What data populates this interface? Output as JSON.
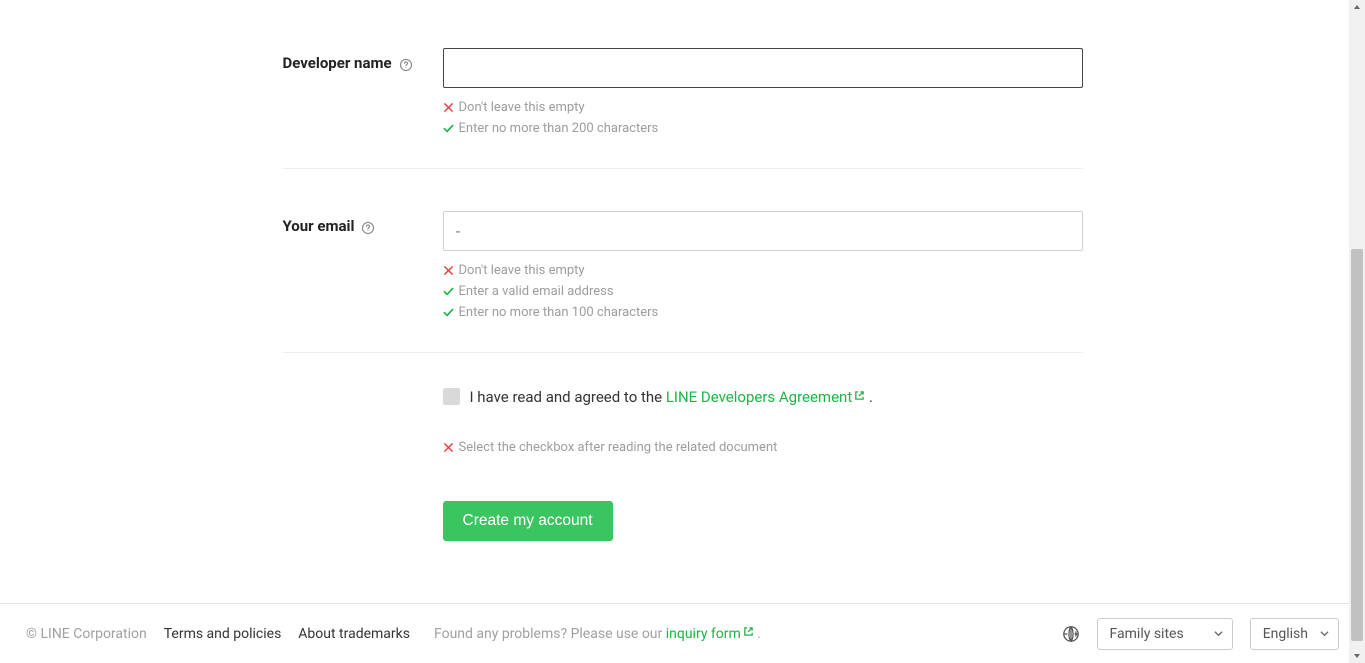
{
  "form": {
    "developer_name": {
      "label": "Developer name",
      "value": "",
      "validations": [
        {
          "status": "error",
          "text": "Don't leave this empty"
        },
        {
          "status": "ok",
          "text": "Enter no more than 200 characters"
        }
      ]
    },
    "email": {
      "label": "Your email",
      "placeholder": "-",
      "value": "",
      "validations": [
        {
          "status": "error",
          "text": "Don't leave this empty"
        },
        {
          "status": "ok",
          "text": "Enter a valid email address"
        },
        {
          "status": "ok",
          "text": "Enter no more than 100 characters"
        }
      ]
    },
    "agreement": {
      "text_before": "I have read and agreed to the ",
      "link_text": "LINE Developers Agreement",
      "text_after": " .",
      "validation": {
        "status": "error",
        "text": "Select the checkbox after reading the related document"
      }
    },
    "submit_label": "Create my account"
  },
  "footer": {
    "copyright": "© LINE Corporation",
    "terms": "Terms and policies",
    "trademarks": "About trademarks",
    "inquiry_before": "Found any problems? Please use our ",
    "inquiry_link": "inquiry form",
    "inquiry_after": " .",
    "family_sites": "Family sites",
    "language": "English"
  }
}
